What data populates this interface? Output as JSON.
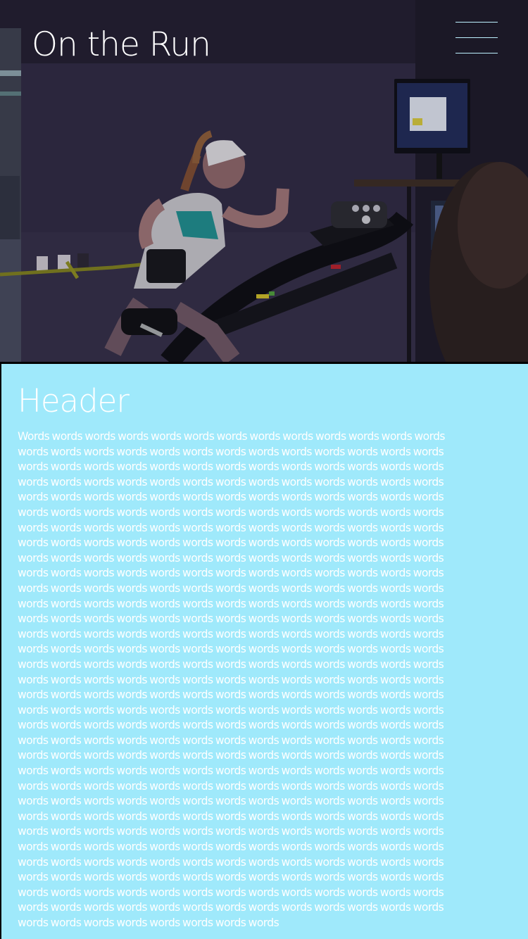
{
  "header": {
    "site_title": "On the Run",
    "menu_icon": "hamburger-menu-icon"
  },
  "hero": {
    "image_subject": "runner on treadmill with monitor"
  },
  "section": {
    "title": "Header",
    "body": "Words words words words words words words words words words words words words words words words words words words words words words words words words words words words words words words words words words words words words words words words words words words words words words words words words words words words words words words words words words words words words words words words words words words words words words words words words words words words words words words words words words words words words words words words words words words words words words words words words words words words words words words words words words words words words words words words words words words words words words words words words words words words words words words words words words words words words words words words words words words words words words words words words words words words words words words words words words words words words words words words words words words words words words words words words words words words words words words words words words words words words words words words words words words words words words words words words words words words words words words words words words words words words words words words words words words words words words words words words words words words words words words words words words words words words words words words words words words words words words words words words words words words words words words words words words words words words words words words words words words words words words words words words words words words words words words words words words words words words words words words words words words words words words words words words words words words words words words words words words words words words words words words words words words words words words words words words words words words words words words words words words words words words words words words words words words words words words words words words words words words words words words words words words words words words words words words words words words words words words words words words words words words words words words words words words words words words words words words words words words words words words words words words words words words words words words words words words words words words words words words words words words words words words words words words words words words words words words words words words words words words words words words"
  },
  "colors": {
    "content_background": "#9fe9fb",
    "text": "#ffffff",
    "hero_background": "#241f30",
    "menu_line": "#bdf1ff"
  }
}
